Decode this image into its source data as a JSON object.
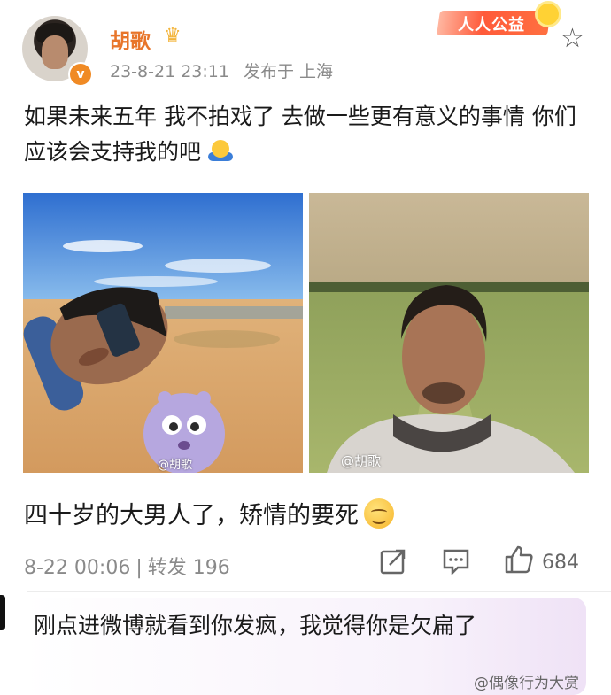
{
  "post": {
    "username": "胡歌",
    "time": "23-8-21 23:11",
    "location": "发布于 上海",
    "text": "如果未来五年 我不拍戏了 去做一些更有意义的事情 你们应该会支持我的吧",
    "badge": "人人公益",
    "photo1_watermark": "@胡歌",
    "photo2_watermark": "@胡歌"
  },
  "repost": {
    "caption": "四十岁的大男人了，矫情的要死",
    "date": "8-22 00:06",
    "forward_label": "转发 196",
    "likes": "684"
  },
  "comment": {
    "text": "刚点进微博就看到你发疯，我觉得你是欠扁了"
  },
  "watermark": "@偶像行为大赏",
  "icons": [
    "verified-icon",
    "crown-icon",
    "star-icon",
    "share-icon",
    "comment-icon",
    "like-icon"
  ]
}
